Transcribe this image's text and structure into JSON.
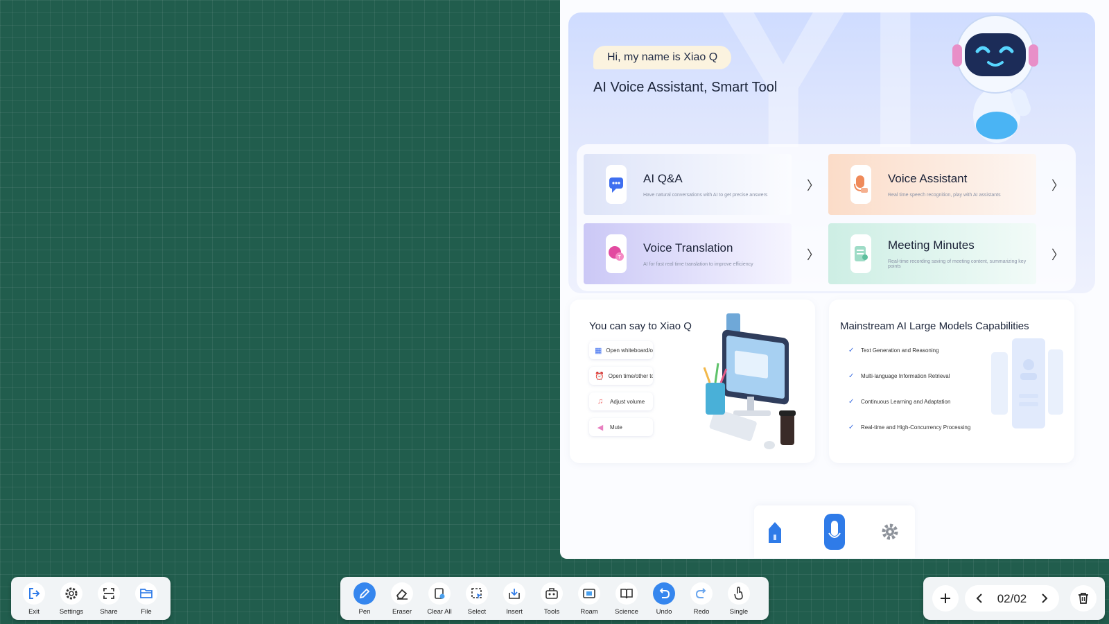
{
  "assistant": {
    "greeting": "Hi, my name is Xiao Q",
    "tagline": "AI Voice Assistant, Smart Tool",
    "watermark": "YI",
    "features": [
      {
        "title": "AI Q&A",
        "desc": "Have natural conversations with AI to get precise answers",
        "icon": "chat-bubble-icon"
      },
      {
        "title": "Voice Assistant",
        "desc": "Real time speech recognition, play with AI assistants",
        "icon": "microphone-icon"
      },
      {
        "title": "Voice Translation",
        "desc": "AI for fast real time translation to improve efficiency",
        "icon": "translate-icon"
      },
      {
        "title": "Meeting Minutes",
        "desc": "Real-time recording saving of meeting content, summarizing key points",
        "icon": "minutes-icon"
      }
    ],
    "arrow": "〉",
    "say": {
      "title": "You can say to Xiao Q",
      "items": [
        {
          "label": "Open whiteboard/other...",
          "icon": "grid-apps-icon"
        },
        {
          "label": "Open time/other tools",
          "icon": "alarm-clock-icon"
        },
        {
          "label": "Adjust volume",
          "icon": "music-note-icon"
        },
        {
          "label": "Mute",
          "icon": "speaker-mute-icon"
        }
      ]
    },
    "models": {
      "title": "Mainstream AI Large Models Capabilities",
      "check": "✓",
      "items": [
        "Text Generation and Reasoning",
        "Multi-language Information Retrieval",
        "Continuous Learning and Adaptation",
        "Real-time and High-Concurrency Processing"
      ]
    },
    "dock": [
      "home-icon",
      "microphone-icon",
      "settings-gear-icon"
    ]
  },
  "toolbar_left": [
    {
      "label": "Exit",
      "icon": "exit-icon"
    },
    {
      "label": "Settings",
      "icon": "gear-icon"
    },
    {
      "label": "Share",
      "icon": "share-scan-icon"
    },
    {
      "label": "File",
      "icon": "folder-icon"
    }
  ],
  "toolbar_mid": [
    {
      "label": "Pen",
      "icon": "pen-icon",
      "active": true
    },
    {
      "label": "Eraser",
      "icon": "eraser-icon"
    },
    {
      "label": "Clear All",
      "icon": "clear-all-icon"
    },
    {
      "label": "Select",
      "icon": "select-icon"
    },
    {
      "label": "Insert",
      "icon": "insert-icon"
    },
    {
      "label": "Tools",
      "icon": "toolbox-icon"
    },
    {
      "label": "Roam",
      "icon": "roam-icon"
    },
    {
      "label": "Science",
      "icon": "book-icon"
    },
    {
      "label": "Undo",
      "icon": "undo-icon",
      "active": true
    },
    {
      "label": "Redo",
      "icon": "redo-icon"
    },
    {
      "label": "Single",
      "icon": "hand-pointer-icon"
    }
  ],
  "pager": {
    "current": "02/02"
  },
  "colors": {
    "board": "#215d4d",
    "accent": "#3586ee",
    "toolbar": "#f1f4f6"
  }
}
